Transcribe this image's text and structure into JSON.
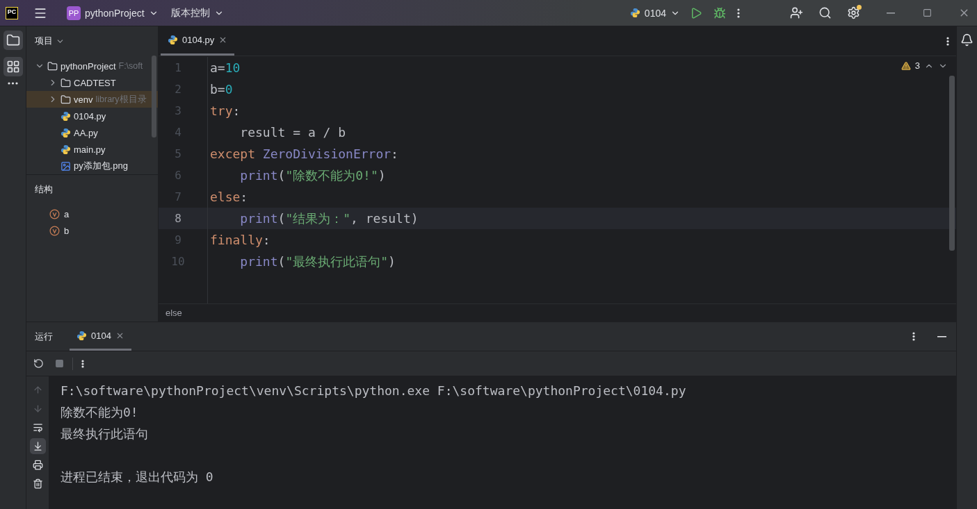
{
  "title_bar": {
    "logo": "PC",
    "project_badge": "PP",
    "project": "pythonProject",
    "vcs": "版本控制",
    "run_config": "0104"
  },
  "project_panel": {
    "title": "项目",
    "tree": [
      {
        "label": "pythonProject",
        "hint": "F:\\soft",
        "kind": "folder",
        "expanded": true,
        "selected": false,
        "children": [
          {
            "label": "CADTEST",
            "kind": "folder",
            "expanded": false,
            "selected": false
          },
          {
            "label": "venv",
            "hint": "library根目录",
            "kind": "folder",
            "expanded": false,
            "selected": true
          },
          {
            "label": "0104.py",
            "kind": "python",
            "selected": false
          },
          {
            "label": "AA.py",
            "kind": "python",
            "selected": false
          },
          {
            "label": "main.py",
            "kind": "python",
            "selected": false
          },
          {
            "label": "py添加包.png",
            "kind": "image",
            "selected": false
          }
        ]
      }
    ]
  },
  "structure_panel": {
    "title": "结构",
    "items": [
      {
        "label": "a",
        "kind": "variable"
      },
      {
        "label": "b",
        "kind": "variable"
      }
    ]
  },
  "editor": {
    "tabs": [
      {
        "label": "0104.py",
        "selected": true
      }
    ],
    "warnings": "3",
    "lines": [
      {
        "number": "1",
        "current": false,
        "indented": false,
        "tokens": [
          {
            "text": "a=",
            "kind": "plain"
          },
          {
            "text": "10",
            "kind": "number"
          }
        ]
      },
      {
        "number": "2",
        "current": false,
        "indented": false,
        "tokens": [
          {
            "text": "b=",
            "kind": "plain"
          },
          {
            "text": "0",
            "kind": "number"
          }
        ]
      },
      {
        "number": "3",
        "current": false,
        "indented": false,
        "tokens": [
          {
            "text": "try",
            "kind": "keyword"
          },
          {
            "text": ":",
            "kind": "plain"
          }
        ]
      },
      {
        "number": "4",
        "current": false,
        "indented": true,
        "tokens": [
          {
            "text": "result = a / b",
            "kind": "plain"
          }
        ]
      },
      {
        "number": "5",
        "current": false,
        "indented": false,
        "tokens": [
          {
            "text": "except ",
            "kind": "keyword"
          },
          {
            "text": "ZeroDivisionError",
            "kind": "builtin"
          },
          {
            "text": ":",
            "kind": "plain"
          }
        ]
      },
      {
        "number": "6",
        "current": false,
        "indented": true,
        "tokens": [
          {
            "text": "print",
            "kind": "builtin"
          },
          {
            "text": "(",
            "kind": "plain"
          },
          {
            "text": "\"除数不能为0!\"",
            "kind": "string"
          },
          {
            "text": ")",
            "kind": "plain"
          }
        ]
      },
      {
        "number": "7",
        "current": false,
        "indented": false,
        "tokens": [
          {
            "text": "else",
            "kind": "keyword"
          },
          {
            "text": ":",
            "kind": "plain"
          }
        ]
      },
      {
        "number": "8",
        "current": true,
        "indented": true,
        "tokens": [
          {
            "text": "print",
            "kind": "builtin"
          },
          {
            "text": "(",
            "kind": "plain"
          },
          {
            "text": "\"结果为：\"",
            "kind": "string"
          },
          {
            "text": ", result)",
            "kind": "plain"
          }
        ]
      },
      {
        "number": "9",
        "current": false,
        "indented": false,
        "tokens": [
          {
            "text": "finally",
            "kind": "keyword"
          },
          {
            "text": ":",
            "kind": "plain"
          }
        ]
      },
      {
        "number": "10",
        "current": false,
        "indented": true,
        "tokens": [
          {
            "text": "print",
            "kind": "builtin"
          },
          {
            "text": "(",
            "kind": "plain"
          },
          {
            "text": "\"最终执行此语句\"",
            "kind": "string"
          },
          {
            "text": ")",
            "kind": "plain"
          }
        ]
      }
    ],
    "breadcrumb": "else"
  },
  "run_panel": {
    "title": "运行",
    "tabs": [
      {
        "label": "0104",
        "selected": true
      }
    ],
    "output_blocks": [
      {
        "lines": [
          "F:\\software\\pythonProject\\venv\\Scripts\\python.exe F:\\software\\pythonProject\\0104.py",
          "除数不能为0!",
          "最终执行此语句"
        ]
      },
      {
        "lines": [
          "进程已结束，退出代码为 0"
        ]
      }
    ]
  }
}
